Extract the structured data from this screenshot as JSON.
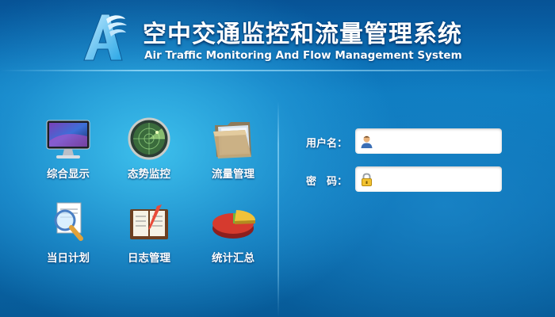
{
  "header": {
    "title_cn": "空中交通监控和流量管理系统",
    "title_en": "Air Traffic Monitoring And Flow Management System",
    "logo_icon": "a-wing-logo-icon"
  },
  "modules": [
    {
      "label": "综合显示",
      "icon": "monitor-icon"
    },
    {
      "label": "态势监控",
      "icon": "radar-icon"
    },
    {
      "label": "流量管理",
      "icon": "folder-icon"
    },
    {
      "label": "当日计划",
      "icon": "document-search-icon"
    },
    {
      "label": "日志管理",
      "icon": "log-book-icon"
    },
    {
      "label": "统计汇总",
      "icon": "pie-chart-icon"
    }
  ],
  "login": {
    "username_label": "用户名：",
    "username_value": "",
    "username_placeholder": "",
    "password_label": "密　码：",
    "password_value": "",
    "password_placeholder": ""
  },
  "colors": {
    "background": "#0b6eb3",
    "accent_glow": "#46cdf5",
    "text": "#ffffff"
  }
}
